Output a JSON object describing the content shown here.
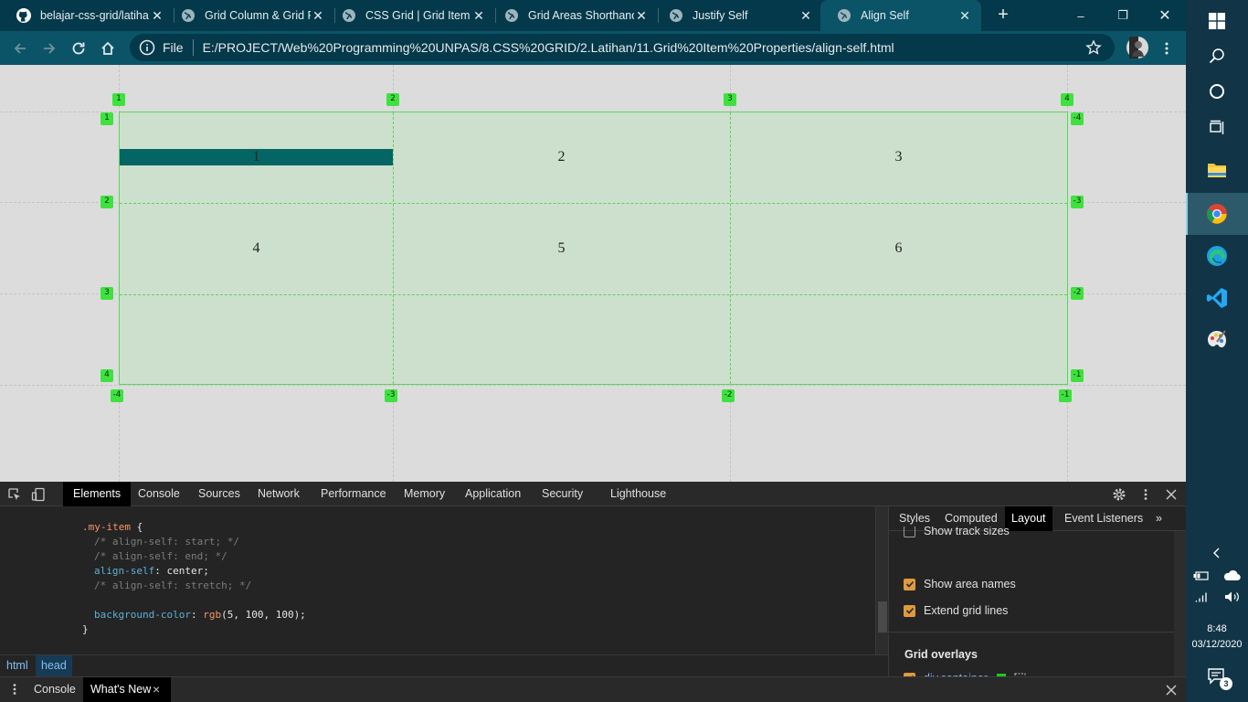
{
  "browser": {
    "tabs": [
      {
        "title": "belajar-css-grid/latiha",
        "favicon": "github-icon",
        "active": false
      },
      {
        "title": "Grid Column & Grid R",
        "favicon": "globe-icon",
        "active": false
      },
      {
        "title": "CSS Grid | Grid Item P",
        "favicon": "globe-icon",
        "active": false
      },
      {
        "title": "Grid Areas Shorthand",
        "favicon": "globe-icon",
        "active": false
      },
      {
        "title": "Justify Self",
        "favicon": "globe-icon",
        "active": false
      },
      {
        "title": "Align Self",
        "favicon": "globe-icon",
        "active": true
      }
    ],
    "new_tab": "+",
    "window_controls": {
      "minimize": "–",
      "restore": "❐",
      "close": "✕"
    },
    "address": {
      "file_label": "File",
      "url": "E:/PROJECT/Web%20Programming%20UNPAS/8.CSS%20GRID/2.Latihan/11.Grid%20Item%20Properties/align-self.html"
    }
  },
  "page": {
    "cells": [
      "1",
      "2",
      "3",
      "4",
      "5",
      "6"
    ],
    "line_labels": {
      "cols_top": [
        "1",
        "2",
        "3",
        "4"
      ],
      "cols_bottom": [
        "-4",
        "-3",
        "-2",
        "-1"
      ],
      "rows_left": [
        "1",
        "2",
        "3",
        "4"
      ],
      "rows_right": [
        "-4",
        "-3",
        "-2",
        "-1"
      ]
    },
    "colors": {
      "grid_fill": "#cde0cd",
      "grid_line": "#58d858",
      "item_bg": "#056464",
      "label_bg": "#3ee23e"
    }
  },
  "devtools": {
    "tabs": [
      "Elements",
      "Console",
      "Sources",
      "Network",
      "Performance",
      "Memory",
      "Application",
      "Security",
      "Lighthouse"
    ],
    "active_tab": "Elements",
    "code": {
      "selector": ".my-item",
      "open_brace": " {",
      "c1": "/* align-self: start; */",
      "c2": "/* align-self: end; */",
      "prop_align": "align-self",
      "val_align": " center;",
      "c3": "/* align-self: stretch; */",
      "prop_bg": "background-color",
      "val_bg_fn": " rgb",
      "val_bg_args": "(5, 100, 100);",
      "close_brace": "}",
      "colon": ":"
    },
    "breadcrumbs": [
      "html",
      "head"
    ],
    "sidebar": {
      "tabs": [
        "Styles",
        "Computed",
        "Layout",
        "Event Listeners"
      ],
      "more": "»",
      "active_tab": "Layout",
      "options": [
        {
          "label": "Show track sizes",
          "checked": false
        },
        {
          "label": "Show area names",
          "checked": true
        },
        {
          "label": "Extend grid lines",
          "checked": true
        }
      ],
      "overlays_title": "Grid overlays",
      "overlay_item": {
        "label": "div.container",
        "checked": true,
        "swatch": "#1ec91e"
      }
    },
    "drawer": {
      "tabs": [
        "Console",
        "What's New"
      ],
      "active": "What's New",
      "close_tab": "×"
    }
  },
  "taskbar": {
    "time": "8:48",
    "date": "03/12/2020",
    "notifications": "3"
  }
}
